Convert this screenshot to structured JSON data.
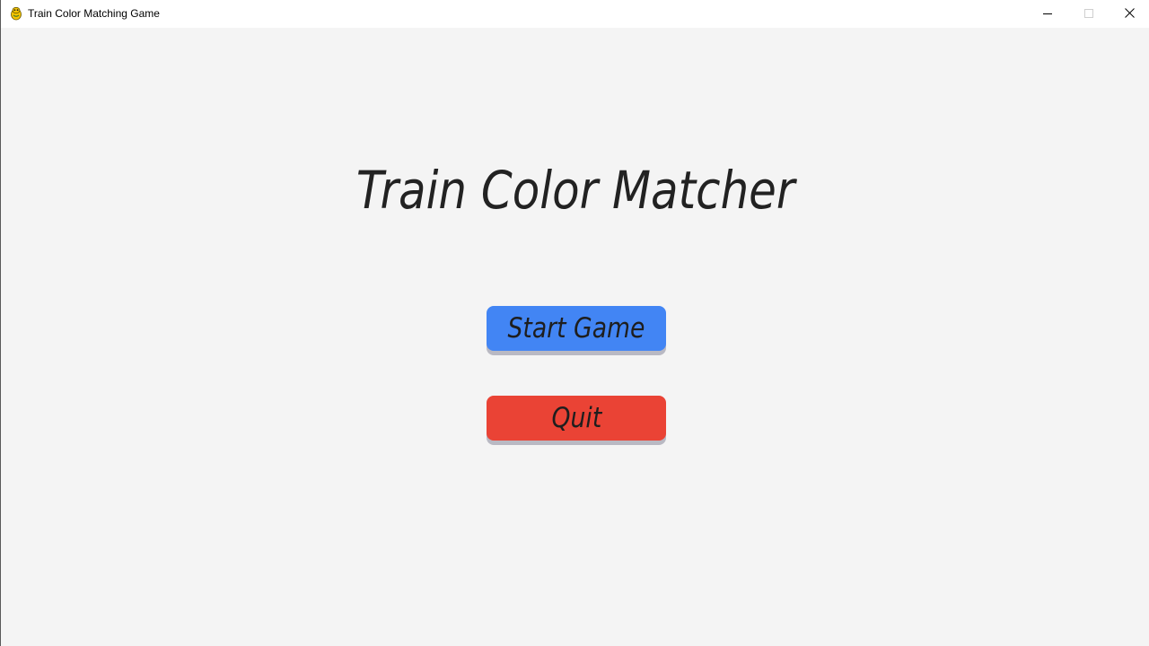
{
  "window": {
    "title": "Train Color Matching Game",
    "app_icon": "pygame-snake-icon",
    "controls": [
      "minimize-icon",
      "maximize-icon",
      "close-icon"
    ]
  },
  "main": {
    "title": "Train Color Matcher",
    "buttons": {
      "start_label": "Start Game",
      "quit_label": "Quit"
    }
  },
  "colors": {
    "background": "#f4f4f4",
    "start_button": "#4285f4",
    "quit_button": "#ea4335",
    "button_shadow": "#b9b9c3",
    "text": "#222222"
  }
}
